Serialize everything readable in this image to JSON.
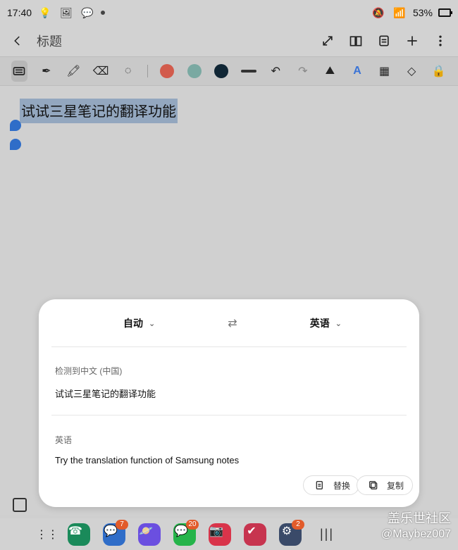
{
  "status": {
    "time": "17:40",
    "battery": "53%"
  },
  "appbar": {
    "title": "标题"
  },
  "editor": {
    "selected_text": "试试三星笔记的翻译功能"
  },
  "colors": {
    "red": "#d25b4c",
    "teal": "#7aa9a2",
    "dark": "#102635"
  },
  "translate": {
    "source_lang": "自动",
    "target_lang": "英语",
    "detected_label": "检测到中文 (中国)",
    "source_text": "试试三星笔记的翻译功能",
    "target_label": "英语",
    "target_text": "Try the translation function of Samsung notes",
    "replace_label": "替换",
    "copy_label": "复制"
  },
  "dock": {
    "messages_badge": "7",
    "wechat_badge": "20",
    "settings_badge": "2"
  },
  "watermark": {
    "line1": "盖乐世社区",
    "line2": "@Maybez007"
  }
}
